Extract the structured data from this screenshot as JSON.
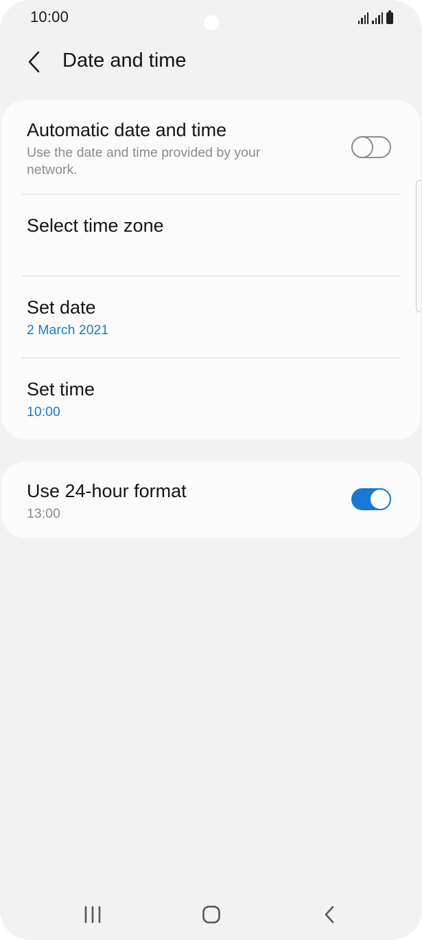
{
  "status_bar": {
    "time": "10:00",
    "icons": [
      "signal-icon",
      "signal-icon",
      "battery-icon"
    ]
  },
  "header": {
    "back_icon": "chevron-left-icon",
    "title": "Date and time"
  },
  "settings": {
    "automatic": {
      "title": "Automatic date and time",
      "subtitle_line1": "Use the date and time provided by your",
      "subtitle_line2": "network.",
      "enabled": false
    },
    "time_zone": {
      "title": "Select time zone"
    },
    "set_date": {
      "title": "Set date",
      "value": "2 March 2021"
    },
    "set_time": {
      "title": "Set time",
      "value": "10:00"
    },
    "format_24h": {
      "title": "Use 24-hour format",
      "subtitle": "13:00",
      "enabled": true
    }
  },
  "colors": {
    "background": "#f2f2f2",
    "card": "#fbfbfb",
    "accent": "#1878d4",
    "link_text": "#1a7bc9"
  },
  "nav_bar": {
    "recents_icon": "recents-icon",
    "home_icon": "home-icon",
    "back_icon": "back-icon"
  }
}
